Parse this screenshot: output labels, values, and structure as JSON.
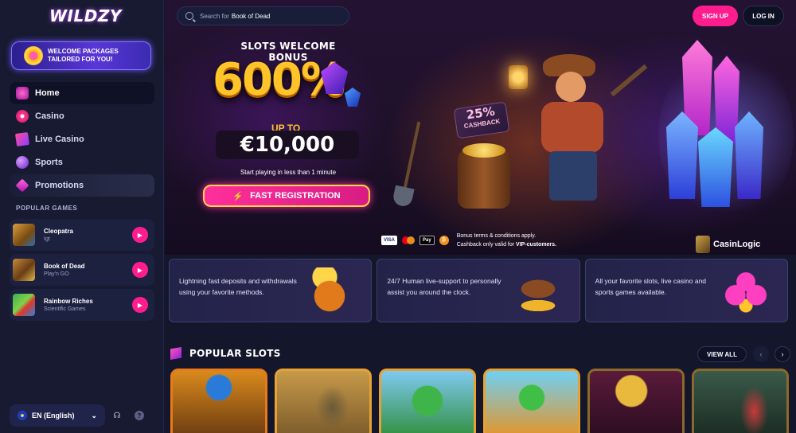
{
  "brand": {
    "logo_text": "WILDZY"
  },
  "sidebar": {
    "promo_banner": "WELCOME PACKAGES TAILORED FOR YOU!",
    "nav": [
      {
        "label": "Home",
        "icon": "home-icon"
      },
      {
        "label": "Casino",
        "icon": "casino-chip-icon"
      },
      {
        "label": "Live Casino",
        "icon": "live-casino-icon"
      },
      {
        "label": "Sports",
        "icon": "sports-ball-icon"
      },
      {
        "label": "Promotions",
        "icon": "promotions-gem-icon"
      }
    ],
    "popular_games_label": "POPULAR GAMES",
    "popular_games": [
      {
        "name": "Cleopatra",
        "provider": "Igt"
      },
      {
        "name": "Book of Dead",
        "provider": "Play'n GO"
      },
      {
        "name": "Rainbow Riches",
        "provider": "Scientific Games"
      }
    ],
    "language": "EN (English)"
  },
  "header": {
    "search_prefix": "Search for",
    "search_suggestion": "Book of Dead",
    "signup_label": "SIGN UP",
    "login_label": "LOG IN"
  },
  "hero": {
    "title": "SLOTS WELCOME BONUS",
    "percent": "600%",
    "up_to": "UP TO",
    "amount": "€10,000",
    "subtitle": "Start playing in less than 1 minute",
    "cta_label": "FAST REGISTRATION",
    "cashback_percent": "25%",
    "cashback_label": "CASHBACK",
    "payment_methods": [
      "VISA",
      "Mastercard",
      "Apple Pay",
      "Bitcoin"
    ],
    "terms_line1": "Bonus terms & conditions apply.",
    "terms_line2_prefix": "Cashback only valid for",
    "terms_line2_bold": "VIP-customers.",
    "watermark": "CasinLogic"
  },
  "features": [
    {
      "text": "Lightning fast deposits and withdrawals using your favorite methods.",
      "icon": "money-bag-icon"
    },
    {
      "text": "24/7 Human live-support to personally assist you around the clock.",
      "icon": "miner-hat-icon"
    },
    {
      "text": "All your favorite slots, live casino and sports games available.",
      "icon": "club-suit-icon"
    }
  ],
  "popular_slots": {
    "title": "POPULAR SLOTS",
    "view_all_label": "VIEW ALL",
    "cards": [
      "eye-of-horus-slot",
      "book-of-dead-slot",
      "leprechaun-slot",
      "rainbow-riches-slot",
      "gold-coins-slot",
      "jungle-queen-slot"
    ]
  },
  "colors": {
    "accent": "#ff1d8e",
    "gold": "#ffc42a",
    "sidebar_bg": "#171a31",
    "page_bg": "#14162b"
  }
}
